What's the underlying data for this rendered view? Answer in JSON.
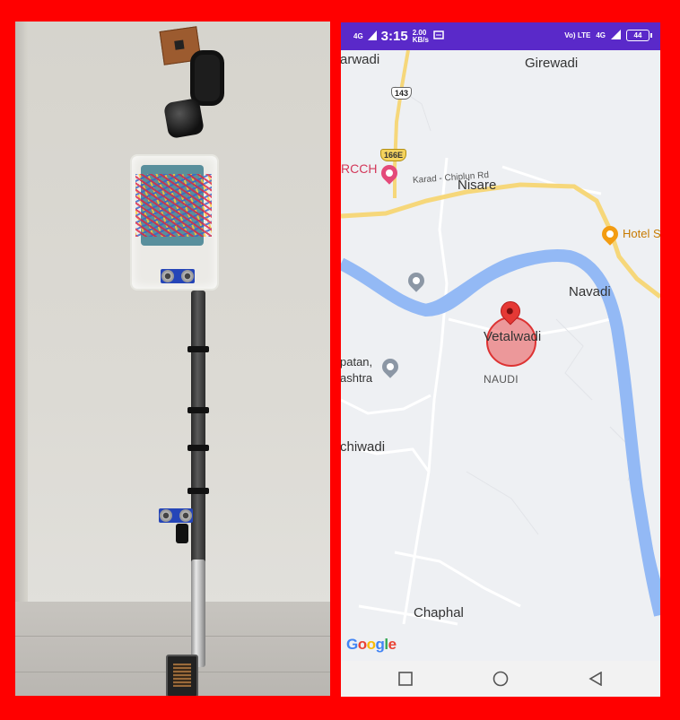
{
  "photo": {
    "subject": "walking-stick-device"
  },
  "phone": {
    "status_bar": {
      "signal": "4G",
      "time": "3:15",
      "speed_value": "2.00",
      "speed_unit": "KB/s",
      "network_right": "Vo) LTE",
      "network_type": "4G",
      "battery": "44"
    },
    "map": {
      "places": [
        {
          "key": "arwadi",
          "label": "arwadi"
        },
        {
          "key": "girewadi",
          "label": "Girewadi"
        },
        {
          "key": "rcch",
          "label": "RCCH"
        },
        {
          "key": "nisare",
          "label": "Nisare"
        },
        {
          "key": "hotel",
          "label": "Hotel S"
        },
        {
          "key": "navadi",
          "label": "Navadi"
        },
        {
          "key": "vetalwadi",
          "label": "Vetalwadi"
        },
        {
          "key": "naudi",
          "label": "NAUDI"
        },
        {
          "key": "patan",
          "label": "patan,"
        },
        {
          "key": "ashtra",
          "label": "ashtra"
        },
        {
          "key": "chiwadi",
          "label": "chiwadi"
        },
        {
          "key": "chaphal",
          "label": "Chaphal"
        }
      ],
      "road_label": "Karad - Chiplun Rd",
      "shields": {
        "nh143": "143",
        "nh166e": "166E"
      },
      "attribution": "Google",
      "colors": {
        "water": "#93b9f5",
        "land": "#eef0f3",
        "road": "#ffffff",
        "highway": "#f6d77a",
        "marker": "#e53935"
      }
    },
    "nav": [
      "square-button",
      "home-button",
      "back-button"
    ]
  }
}
